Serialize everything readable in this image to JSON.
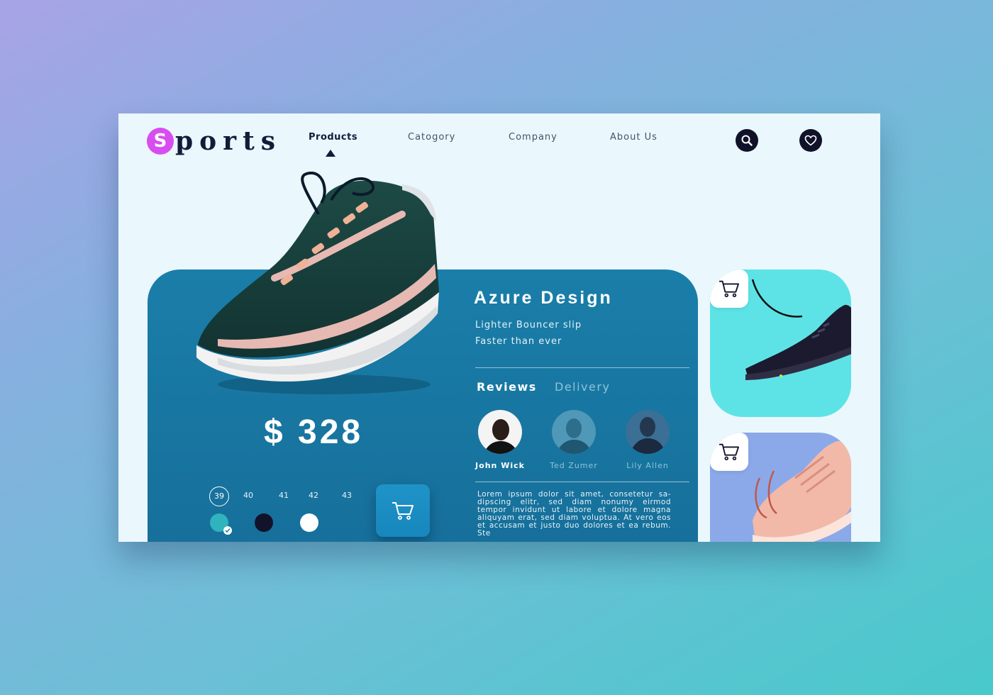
{
  "brand": {
    "logo_initial": "S",
    "logo_rest": "ports"
  },
  "nav": {
    "items": [
      "Products",
      "Catogory",
      "Company",
      "About Us"
    ],
    "active": "Products"
  },
  "header_icons": [
    "search-icon",
    "heart-icon"
  ],
  "product": {
    "title": "Azure Design",
    "subtitle_line1": "Lighter Bouncer slip",
    "subtitle_line2": "Faster than ever",
    "price": "$ 328",
    "sizes": [
      "39",
      "40",
      "41",
      "42",
      "43"
    ],
    "selected_size": "39",
    "colors": [
      "#2fb3bd",
      "#12132b",
      "#ffffff"
    ],
    "selected_color": "#2fb3bd",
    "cart_icon": "cart-icon"
  },
  "tabs": {
    "items": [
      "Reviews",
      "Delivery"
    ],
    "active": "Reviews"
  },
  "reviewers": [
    {
      "name": "John Wick",
      "active": true
    },
    {
      "name": "Ted Zumer",
      "active": false
    },
    {
      "name": "Lily Allen",
      "active": false
    }
  ],
  "description": "Lorem ipsum dolor sit amet, consetetur sa- dipscing elitr, sed diam nonumy eirmod tempor invidunt ut labore et dolore magna aliquyam erat, sed diam voluptua. At vero eos et accusam et justo duo dolores et ea rebum. Ste",
  "side_cards": [
    {
      "bg": "#5de3e6",
      "shoe_color": "#1b1a2e",
      "icon": "cart-icon"
    },
    {
      "bg": "#8ba9e8",
      "shoe_color": "#f2b9a8",
      "icon": "cart-icon"
    }
  ],
  "colors": {
    "accent": "#d84df0",
    "primary": "#1a7ea9",
    "dark": "#141a3a",
    "panel": "#eaf7fc"
  }
}
